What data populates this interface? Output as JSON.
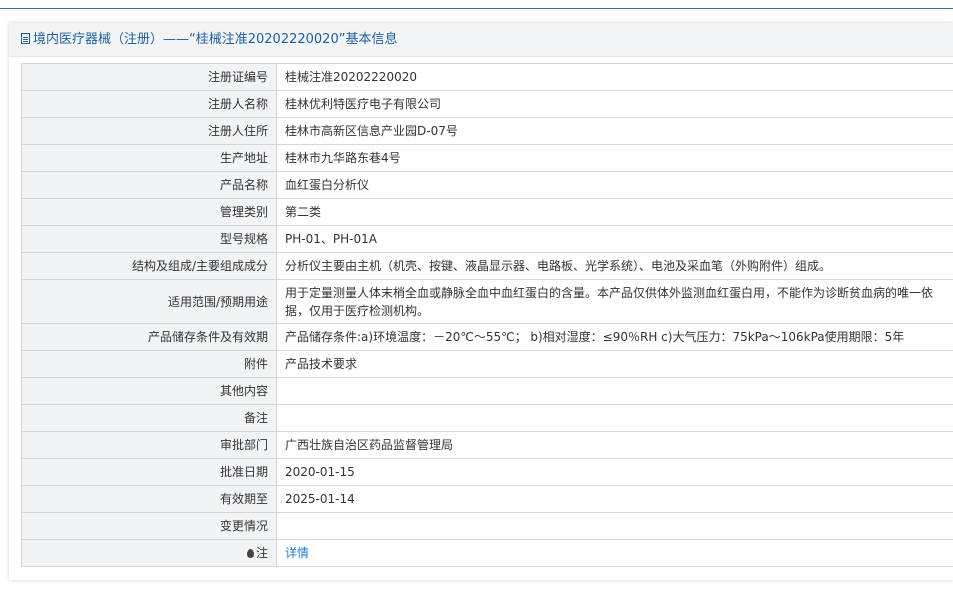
{
  "header": {
    "icon": "document-icon",
    "title": "境内医疗器械（注册）——“桂械注准20202220020”基本信息"
  },
  "rows": [
    {
      "label": "注册证编号",
      "value": "桂械注准20202220020"
    },
    {
      "label": "注册人名称",
      "value": "桂林优利特医疗电子有限公司"
    },
    {
      "label": "注册人住所",
      "value": "桂林市高新区信息产业园D-07号"
    },
    {
      "label": "生产地址",
      "value": "桂林市九华路东巷4号"
    },
    {
      "label": "产品名称",
      "value": "血红蛋白分析仪"
    },
    {
      "label": "管理类别",
      "value": "第二类"
    },
    {
      "label": "型号规格",
      "value": "PH-01、PH-01A"
    },
    {
      "label": "结构及组成/主要组成成分",
      "value": "分析仪主要由主机（机壳、按键、液晶显示器、电路板、光学系统）、电池及采血笔（外购附件）组成。"
    },
    {
      "label": "适用范围/预期用途",
      "value": "用于定量测量人体末梢全血或静脉全血中血红蛋白的含量。本产品仅供体外监测血红蛋白用，不能作为诊断贫血病的唯一依据，仅用于医疗检测机构。"
    },
    {
      "label": "产品储存条件及有效期",
      "value": "产品储存条件:a)环境温度：－20℃～55℃； b)相对湿度：≤90％RH c)大气压力：75kPa～106kPa使用期限：5年"
    },
    {
      "label": "附件",
      "value": "产品技术要求"
    },
    {
      "label": "其他内容",
      "value": ""
    },
    {
      "label": "备注",
      "value": ""
    },
    {
      "label": "审批部门",
      "value": "广西壮族自治区药品监督管理局"
    },
    {
      "label": "批准日期",
      "value": "2020-01-15"
    },
    {
      "label": "有效期至",
      "value": "2025-01-14"
    },
    {
      "label": "变更情况",
      "value": ""
    }
  ],
  "note_row": {
    "icon": "pin-icon",
    "label": "注",
    "link_text": "详情"
  }
}
